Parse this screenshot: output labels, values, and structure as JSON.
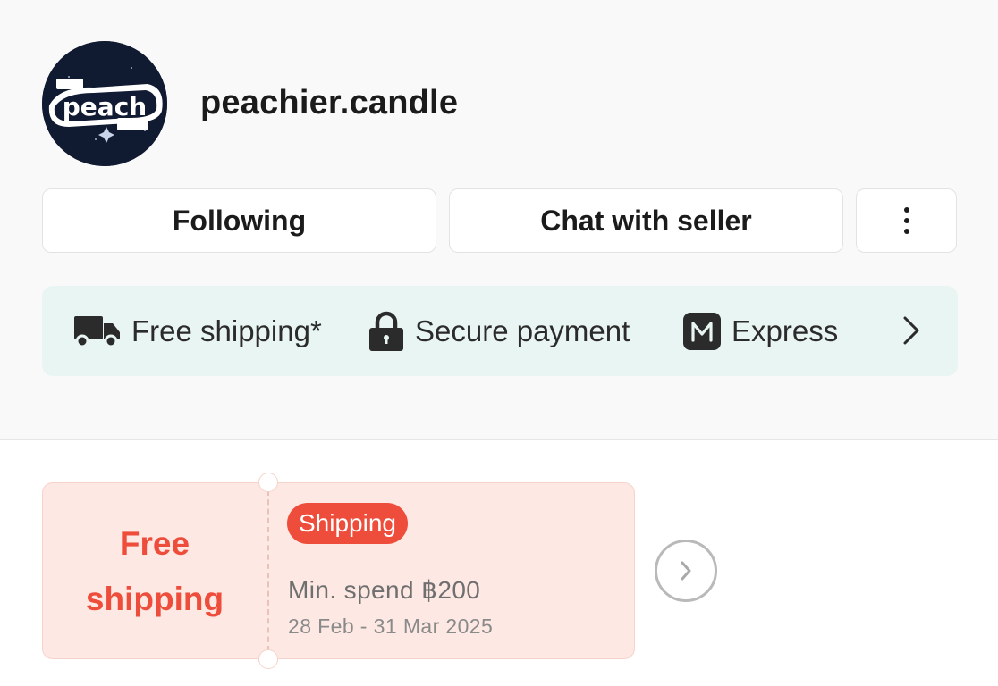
{
  "shop": {
    "name": "peachier.candle",
    "logo_text": "peach"
  },
  "actions": {
    "following_label": "Following",
    "chat_label": "Chat with seller",
    "more_icon": "more-vertical-icon"
  },
  "perks": {
    "items": [
      {
        "label": "Free shipping*",
        "icon": "truck-icon"
      },
      {
        "label": "Secure payment",
        "icon": "lock-icon"
      },
      {
        "label": "Express",
        "icon": "express-icon"
      }
    ],
    "chevron_icon": "chevron-right-icon"
  },
  "voucher": {
    "title_line1": "Free",
    "title_line2": "shipping",
    "badge": "Shipping",
    "min_spend": "Min. spend ฿200",
    "validity": "28 Feb - 31 Mar 2025"
  },
  "colors": {
    "accent": "#ee4d3c",
    "voucher_bg": "#fde8e3",
    "perks_bg": "#e9f5f2"
  }
}
